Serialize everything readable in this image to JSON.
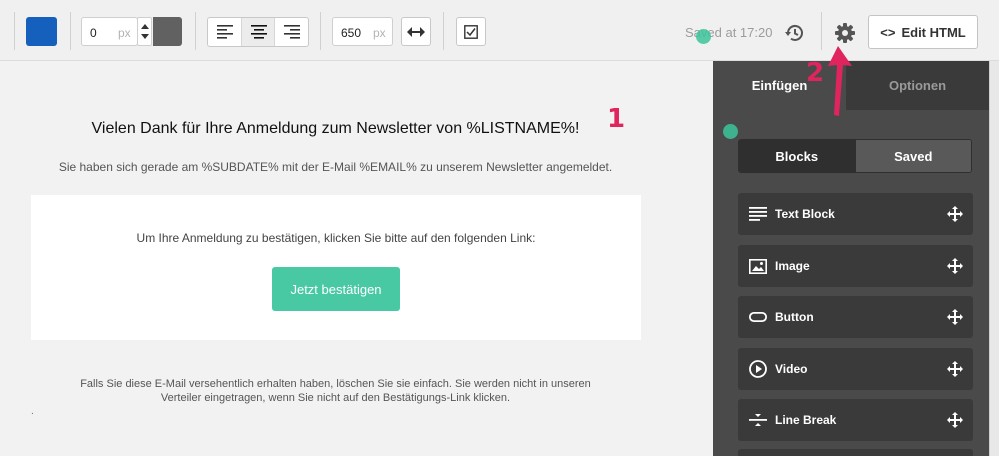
{
  "toolbar": {
    "bg_color": "#1560bd",
    "border_width": {
      "value": "0",
      "unit": "px"
    },
    "border_color": "#616161",
    "alignment": {
      "options": [
        "align-left",
        "align-center",
        "align-right"
      ],
      "active": "align-center"
    },
    "width": {
      "value": "650",
      "unit": "px"
    },
    "saved_status": "Saved at 17:20",
    "edit_html_label": "Edit HTML",
    "edit_html_icon": "<>"
  },
  "canvas": {
    "headline": "Vielen Dank für Ihre Anmeldung zum Newsletter von  %LISTNAME%!",
    "subline": "Sie haben sich gerade am  %SUBDATE% mit der E-Mail %EMAIL% zu unserem Newsletter angemeldet.",
    "card_text": "Um Ihre Anmeldung zu bestätigen, klicken Sie bitte auf den folgenden Link:",
    "confirm_button": "Jetzt bestätigen",
    "footer_line1": "Falls Sie diese E-Mail versehentlich erhalten haben, löschen Sie sie einfach. Sie werden nicht in unseren",
    "footer_line2": "Verteiler eingetragen, wenn Sie nicht auf den Bestätigungs-Link klicken.",
    "dot": "."
  },
  "annotations": {
    "one": "1",
    "two": "2",
    "color": "#e0245e"
  },
  "sidebar": {
    "tabs": [
      {
        "label": "Einfügen"
      },
      {
        "label": "Optionen"
      }
    ],
    "segment": [
      {
        "label": "Blocks"
      },
      {
        "label": "Saved"
      }
    ],
    "blocks": [
      {
        "label": "Text Block",
        "icon": "text-block-icon"
      },
      {
        "label": "Image",
        "icon": "image-icon"
      },
      {
        "label": "Button",
        "icon": "button-icon"
      },
      {
        "label": "Video",
        "icon": "video-icon"
      },
      {
        "label": "Line Break",
        "icon": "line-break-icon"
      }
    ]
  },
  "colors": {
    "accent_green": "#48c9a4",
    "sidebar_bg": "#4a4a4a"
  }
}
